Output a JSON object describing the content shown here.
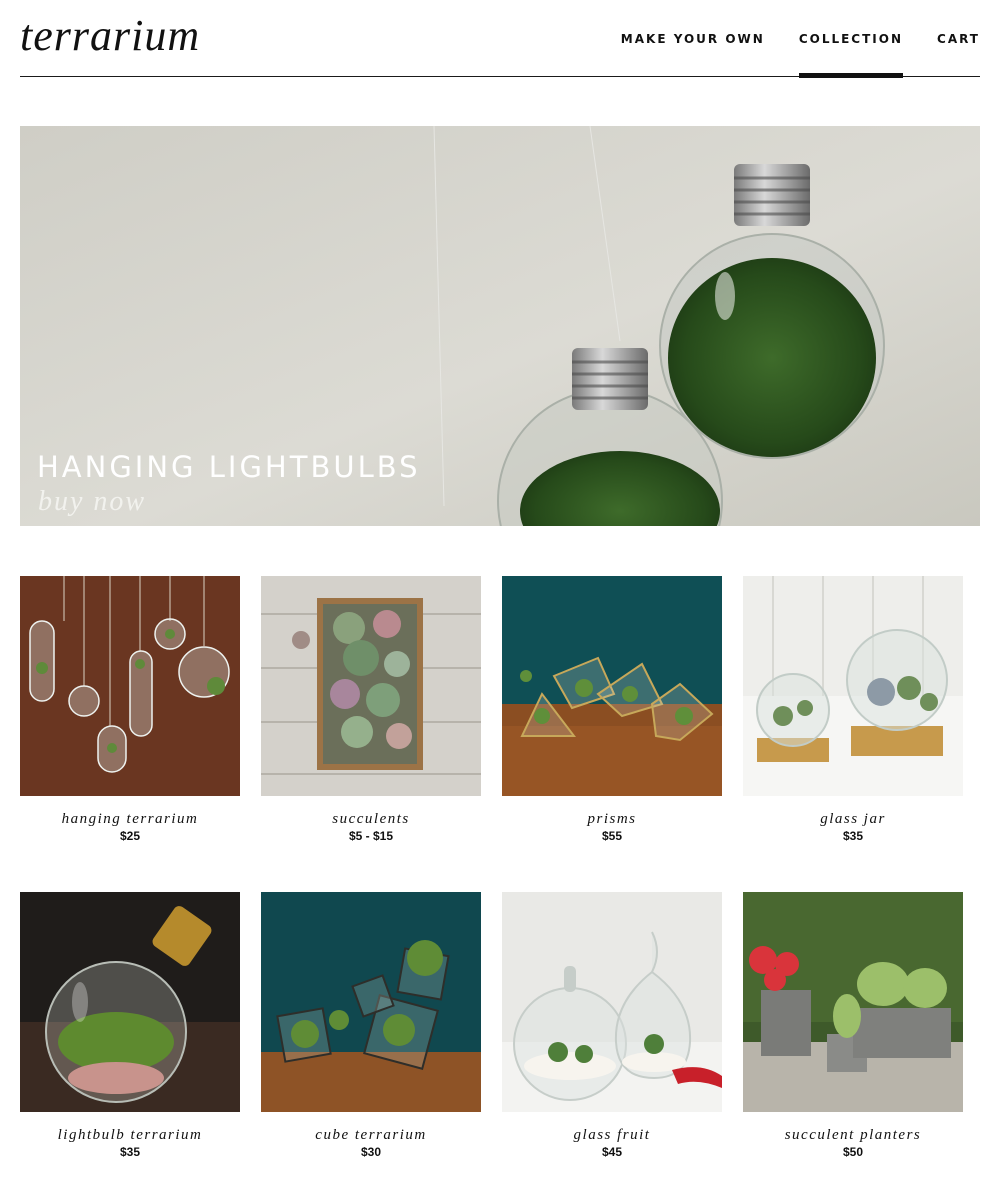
{
  "header": {
    "logo": "terrarium",
    "nav": [
      "MAKE YOUR OWN",
      "COLLECTION",
      "CART"
    ]
  },
  "hero": {
    "title": "HANGING LIGHTBULBS",
    "subtitle": "buy now"
  },
  "products": [
    {
      "name": "hanging terrarium",
      "price": "$25"
    },
    {
      "name": "succulents",
      "price": "$5 - $15"
    },
    {
      "name": "prisms",
      "price": "$55"
    },
    {
      "name": "glass jar",
      "price": "$35"
    },
    {
      "name": "lightbulb terrarium",
      "price": "$35"
    },
    {
      "name": "cube terrarium",
      "price": "$30"
    },
    {
      "name": "glass fruit",
      "price": "$45"
    },
    {
      "name": "succulent planters",
      "price": "$50"
    }
  ]
}
